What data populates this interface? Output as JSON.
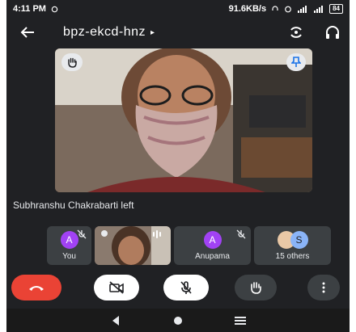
{
  "status_bar": {
    "time": "4:11 PM",
    "network_speed": "91.6KB/s",
    "battery": "84"
  },
  "app_bar": {
    "meeting_code": "bpz-ekcd-hnz",
    "caret": "▸"
  },
  "main_video": {
    "participant": "",
    "hand_raised": true,
    "pinned": true
  },
  "toast": {
    "text": "Subhranshu Chakrabarti left"
  },
  "participant_tiles": [
    {
      "name": "You",
      "avatar_letter": "A",
      "muted": true
    },
    {
      "name": "",
      "avatar_letter": "",
      "type": "video",
      "speaking": true
    },
    {
      "name": "Anupama",
      "avatar_letter": "A",
      "muted": true
    },
    {
      "name": "15 others",
      "avatar_letter": "S"
    }
  ],
  "controls": {
    "end_call": "end-call",
    "camera": "camera-off",
    "microphone": "mic-off",
    "raise_hand": "raise-hand",
    "more": "more-options"
  },
  "colors": {
    "background": "#202124",
    "end_call": "#ea4335",
    "avatar": "#a142f4",
    "tile": "#3c4043"
  }
}
